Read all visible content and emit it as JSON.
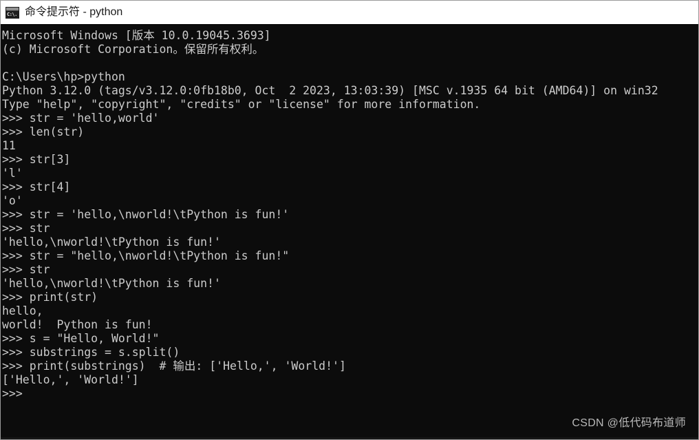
{
  "window": {
    "title": "命令提示符 - python",
    "icon": "cmd-console-icon",
    "icon_glyph": "C:\\.",
    "background_color": "#0c0c0c",
    "text_color": "#cccccc",
    "titlebar_color": "#ffffff"
  },
  "console": {
    "lines": [
      "Microsoft Windows [版本 10.0.19045.3693]",
      "(c) Microsoft Corporation。保留所有权利。",
      "",
      "C:\\Users\\hp>python",
      "Python 3.12.0 (tags/v3.12.0:0fb18b0, Oct  2 2023, 13:03:39) [MSC v.1935 64 bit (AMD64)] on win32",
      "Type \"help\", \"copyright\", \"credits\" or \"license\" for more information.",
      ">>> str = 'hello,world'",
      ">>> len(str)",
      "11",
      ">>> str[3]",
      "'l'",
      ">>> str[4]",
      "'o'",
      ">>> str = 'hello,\\nworld!\\tPython is fun!'",
      ">>> str",
      "'hello,\\nworld!\\tPython is fun!'",
      ">>> str = \"hello,\\nworld!\\tPython is fun!\"",
      ">>> str",
      "'hello,\\nworld!\\tPython is fun!'",
      ">>> print(str)",
      "hello,",
      "world!  Python is fun!",
      ">>> s = \"Hello, World!\"",
      ">>> substrings = s.split()",
      ">>> print(substrings)  # 输出: ['Hello,', 'World!']",
      "['Hello,', 'World!']",
      ">>>"
    ]
  },
  "watermark": {
    "text": "CSDN @低代码布道师"
  }
}
